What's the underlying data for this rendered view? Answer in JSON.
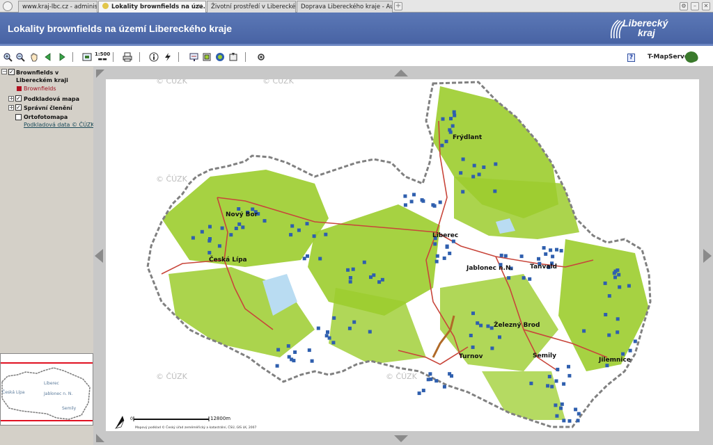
{
  "browser": {
    "tabs": [
      {
        "label": "www.kraj-lbc.cz - administrace",
        "active": false
      },
      {
        "label": "Lokality brownfields na úze...",
        "active": true
      },
      {
        "label": "Životní prostředí v Libereckém kraji",
        "active": false
      },
      {
        "label": "Doprava Libereckého kraje - Autobu...",
        "active": false
      }
    ],
    "new_tab_symbol": "+"
  },
  "header": {
    "title": "Lokality brownfields na území Libereckého kraje",
    "logo_line1": "Liberecký",
    "logo_line2": "kraj",
    "background": "#4f6cae"
  },
  "toolbar": {
    "tools": [
      "zoom-in-icon",
      "zoom-out-icon",
      "pan-hand-icon",
      "previous-view-icon",
      "next-view-icon",
      "full-extent-icon",
      "print-icon",
      "info-icon",
      "hyperlink-icon",
      "measure-icon",
      "layers-icon",
      "identify-icon",
      "export-icon",
      "settings-icon"
    ],
    "scale_button": "1:500",
    "help_label": "?",
    "service_name": "T-MapServer"
  },
  "sidebar": {
    "root_layer": {
      "line1": "Brownfields v",
      "line2": "Libereckém kraji",
      "checked": true
    },
    "legend_item": {
      "label": "Brownfields",
      "color": "#b21020"
    },
    "layers": [
      {
        "label": "Podkladová mapa",
        "checked": true,
        "expandable": true
      },
      {
        "label": "Správní členění",
        "checked": true,
        "expandable": true
      },
      {
        "label": "Ortofotomapa",
        "checked": false,
        "expandable": false
      }
    ],
    "data_link": "Podkladová data © ČÚZK"
  },
  "overview": {
    "labels": [
      "Česká Lípa",
      "Liberec",
      "Jablonec n. N.",
      "Semily"
    ]
  },
  "map": {
    "watermark": "© ČÚZK",
    "cities": [
      "Frýdlant",
      "Nový Bor",
      "Liberec",
      "Česká Lípa",
      "Jablonec n.N.",
      "Tanvald",
      "Železný Brod",
      "Turnov",
      "Semily",
      "Jilemnice"
    ],
    "scalebar_start": "0",
    "scalebar_end": "12800m",
    "credit": "Mapový podklad © Český úřad zeměměřický a katastrální, ČSÚ, GIS LK, 2007",
    "colors": {
      "forest": "#9ccd2e",
      "brownfield": "#2f5fae",
      "road": "#c8453a",
      "border": "#808080"
    }
  }
}
